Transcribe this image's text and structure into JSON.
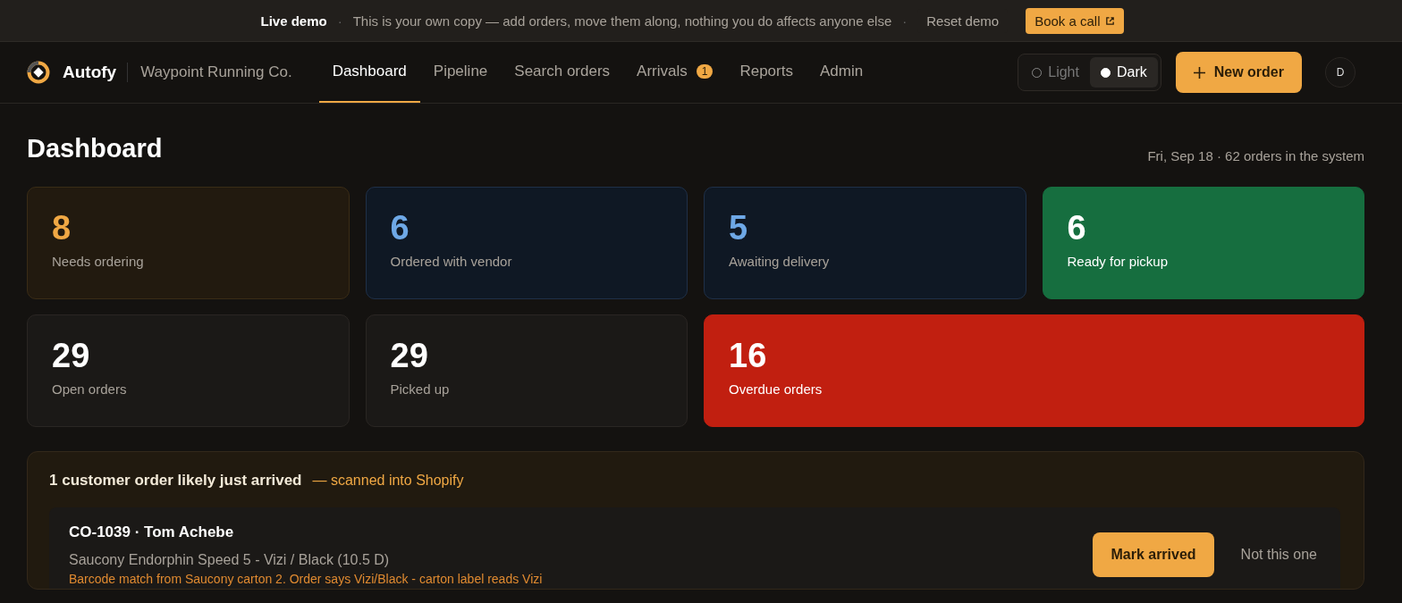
{
  "demo_banner": {
    "title": "Live demo",
    "separator_1": "·",
    "message": "This is your own copy — add orders, move them along, nothing you do affects anyone else",
    "separator_2": "·",
    "reset": "Reset demo",
    "cta": "Book a call"
  },
  "header": {
    "brand": "Autofy",
    "store": "Waypoint Running Co.",
    "nav": [
      {
        "label": "Dashboard",
        "selected": true
      },
      {
        "label": "Pipeline",
        "selected": false
      },
      {
        "label": "Search orders",
        "selected": false
      },
      {
        "label": "Arrivals",
        "selected": false,
        "badge": "1"
      },
      {
        "label": "Reports",
        "selected": false
      },
      {
        "label": "Admin",
        "selected": false
      }
    ],
    "theme": [
      {
        "label": "Light",
        "selected": false
      },
      {
        "label": "Dark",
        "selected": true
      }
    ],
    "new_order": "New order",
    "avatar": "D"
  },
  "page": {
    "title": "Dashboard",
    "subtitle": "Fri, Sep 18 · 62 orders in the system"
  },
  "stats": [
    {
      "value": "8",
      "label": "Needs ordering",
      "kind": "amber"
    },
    {
      "value": "6",
      "label": "Ordered with vendor",
      "kind": "blue"
    },
    {
      "value": "5",
      "label": "Awaiting delivery",
      "kind": "blue"
    },
    {
      "value": "6",
      "label": "Ready for pickup",
      "kind": "green"
    },
    {
      "value": "29",
      "label": "Open orders",
      "kind": "plain"
    },
    {
      "value": "29",
      "label": "Picked up",
      "kind": "plain"
    },
    {
      "value": "16",
      "label": "Overdue orders",
      "kind": "alert"
    }
  ],
  "arrivals": {
    "title": "1 customer order likely just arrived",
    "note": "— scanned into Shopify",
    "orders": [
      {
        "title": "CO-1039 · Tom Achebe",
        "item": "Saucony Endorphin Speed 5 - Vizi / Black (10.5 D)",
        "match": "Barcode match from Saucony carton 2. Order says Vizi/Black - carton label reads Vizi",
        "confirm": "Mark arrived",
        "dismiss": "Not this one"
      }
    ]
  }
}
